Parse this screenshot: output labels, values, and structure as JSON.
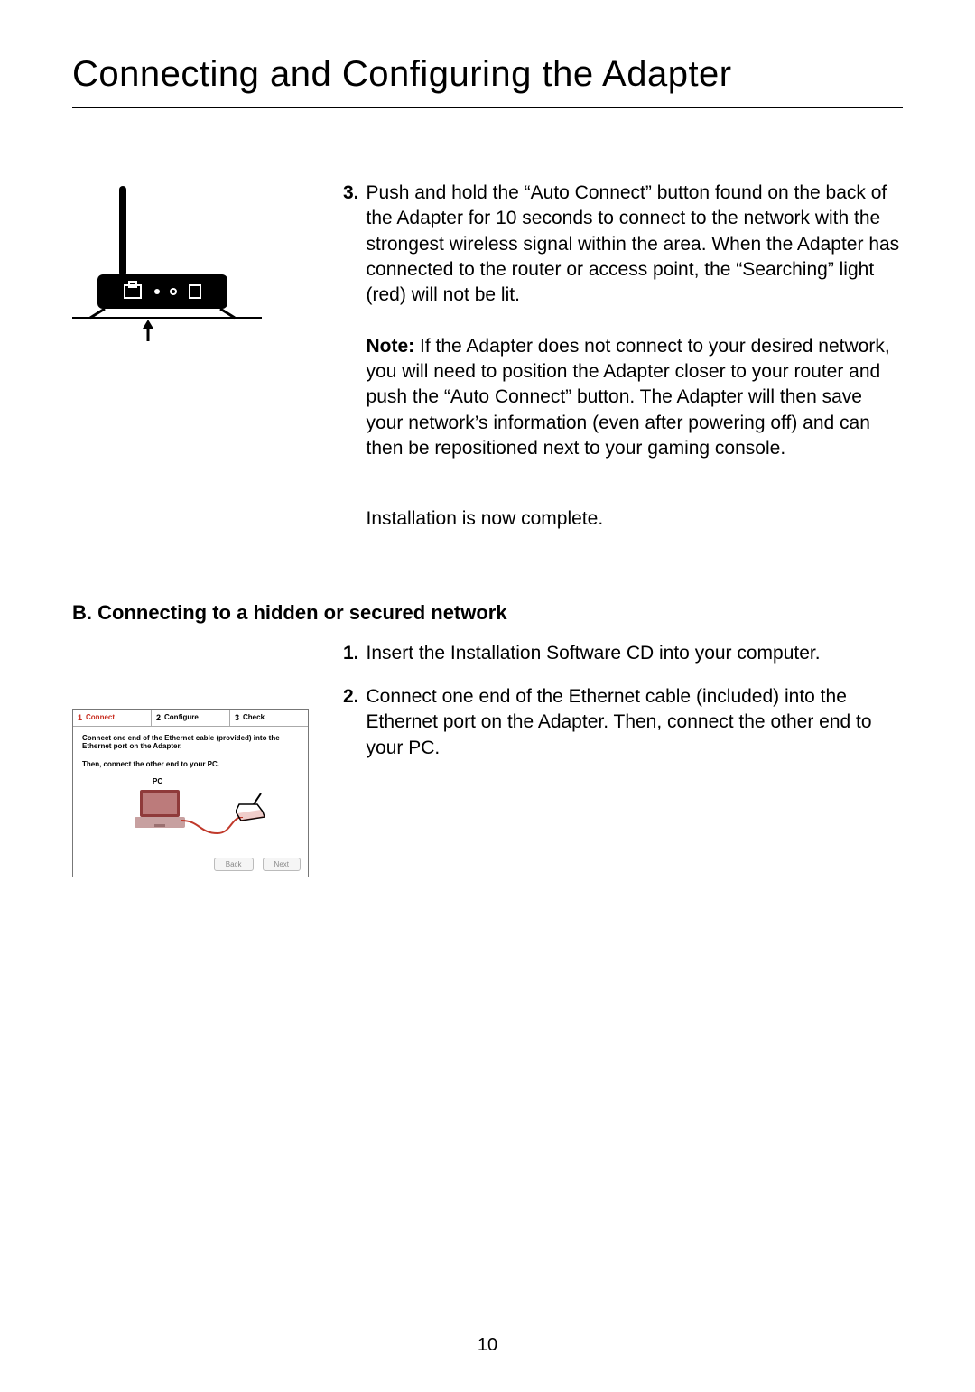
{
  "title": "Connecting and Configuring the Adapter",
  "step3": {
    "num": "3.",
    "text": "Push and hold the “Auto Connect” button found on the back of the Adapter for 10 seconds to connect to the network with the strongest wireless signal within the area. When the Adapter has connected to the router or access point, the “Searching” light (red) will not be lit."
  },
  "note": {
    "label": "Note:",
    "text": " If the Adapter does not connect to your desired network, you will need to position the Adapter closer to your router and push the “Auto Connect” button. The Adapter will then save your network’s information (even after powering off) and can then be repositioned next to your gaming console."
  },
  "install_complete": "Installation is now complete.",
  "section_b_heading": "B.  Connecting to a hidden or secured network",
  "b_step1": {
    "num": "1.",
    "text": "Insert the Installation Software CD into your computer."
  },
  "b_step2": {
    "num": "2.",
    "text": "Connect one end of the Ethernet cable (included) into the Ethernet port on the Adapter. Then, connect the other end to your PC."
  },
  "installer": {
    "tabs": [
      {
        "num": "1",
        "label": "Connect"
      },
      {
        "num": "2",
        "label": "Configure"
      },
      {
        "num": "3",
        "label": "Check"
      }
    ],
    "body1": "Connect one end of the Ethernet cable (provided) into the Ethernet port on the Adapter.",
    "body2": "Then, connect the other end to your PC.",
    "pc_label": "PC",
    "back": "Back",
    "next": "Next"
  },
  "page_number": "10"
}
